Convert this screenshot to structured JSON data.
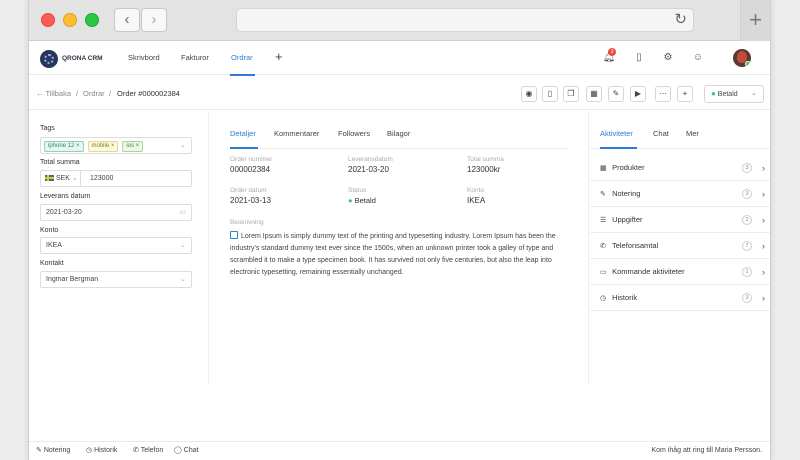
{
  "app": {
    "logo_text": "QRONA CRM"
  },
  "topnav": [
    {
      "label": "Skrivbord"
    },
    {
      "label": "Fakturor"
    },
    {
      "label": "Ordrar"
    }
  ],
  "notification_count": "3",
  "breadcrumb": {
    "back": "Tillbaka",
    "section": "Ordrar",
    "current": "Order #000002384"
  },
  "status_dropdown": {
    "value": "Betald",
    "color": "#2ecc71"
  },
  "left": {
    "tags_label": "Tags",
    "tags": [
      "iphone 12",
      "mobile",
      "ios"
    ],
    "total_label": "Total summa",
    "currency": "SEK",
    "total_value": "123000",
    "delivery_label": "Leverans datum",
    "delivery_value": "2021-03-20",
    "account_label": "Konto",
    "account_value": "IKEA",
    "contact_label": "Kontakt",
    "contact_value": "Ingmar Bergman"
  },
  "tabs": [
    {
      "label": "Detaljer"
    },
    {
      "label": "Kommentarer"
    },
    {
      "label": "Followers"
    },
    {
      "label": "Bilagor"
    }
  ],
  "details": {
    "order_number_label": "Order nummer",
    "order_number": "000002384",
    "delivery_label": "Leveransdatum",
    "delivery": "2021-03-20",
    "total_label": "Total summa",
    "total": "123000kr",
    "order_date_label": "Order datum",
    "order_date": "2021-03-13",
    "status_label": "Status",
    "status": "Betald",
    "account_label": "Konto",
    "account": "IKEA",
    "description_label": "Beskrivning",
    "description": "Lorem Ipsum is simply dummy text of the printing and typesetting industry. Lorem Ipsum has been the industry's standard dummy text ever since the 1500s, when an unknown printer took a galley of type and scrambled it to make a type specimen book. It has survived not only five centuries, but also the leap into electronic typesetting, remaining essentially unchanged."
  },
  "right_tabs": [
    {
      "label": "Aktiviteter"
    },
    {
      "label": "Chat"
    },
    {
      "label": "Mer"
    }
  ],
  "activities": [
    {
      "label": "Produkter",
      "count": "3",
      "icon": "grid-icon"
    },
    {
      "label": "Notering",
      "count": "3",
      "icon": "note-icon"
    },
    {
      "label": "Uppgifter",
      "count": "2",
      "icon": "list-icon"
    },
    {
      "label": "Telefonsamtal",
      "count": "7",
      "icon": "phone-icon"
    },
    {
      "label": "Kommande aktiviteter",
      "count": "1",
      "icon": "calendar-icon"
    },
    {
      "label": "Historik",
      "count": "3",
      "icon": "history-icon"
    }
  ],
  "footer": {
    "items": [
      {
        "label": "Notering"
      },
      {
        "label": "Historik"
      },
      {
        "label": "Telefon"
      },
      {
        "label": "Chat"
      }
    ],
    "message": "Kom ihåg att ring till Maria Persson."
  },
  "colors": {
    "accent": "#2d7dd2",
    "success": "#2ecc71",
    "badge": "#e74c3c"
  }
}
